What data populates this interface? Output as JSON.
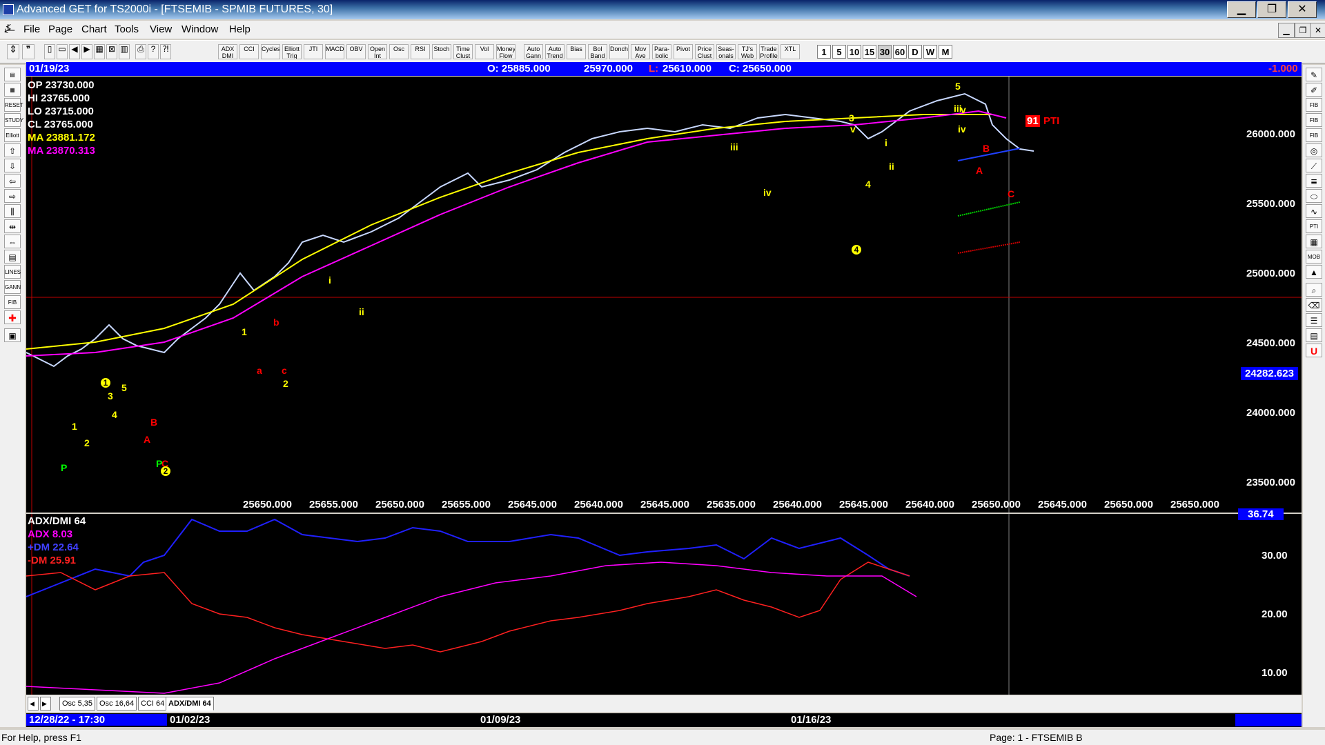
{
  "window": {
    "title": "Advanced GET for TS2000i - [FTSEMIB - SPMIB FUTURES, 30]",
    "minimize": "▁",
    "restore": "❐",
    "close": "✕"
  },
  "menu": [
    "File",
    "Page",
    "Chart",
    "Tools",
    "View",
    "Window",
    "Help"
  ],
  "toolbar": {
    "study_buttons": [
      "ADX DMI",
      "CCI",
      "Cycles",
      "Elliott Trig",
      "JTI",
      "MACD",
      "OBV",
      "Open Int",
      "Osc",
      "RSI",
      "Stoch",
      "Time Clust",
      "Vol",
      "Money Flow",
      "Auto Gann",
      "Auto Trend",
      "Bias",
      "Bol Band",
      "Donch",
      "Mov Ave",
      "Para-bolic",
      "Pivot",
      "Price Clust",
      "Seas-onals",
      "TJ's Web",
      "Trade Profile",
      "XTL"
    ],
    "intervals": [
      "1",
      "5",
      "10",
      "15",
      "30",
      "60",
      "D",
      "W",
      "M"
    ],
    "active_interval": "30"
  },
  "infobar": {
    "date": "01/19/23",
    "open": "O: 25885.000",
    "high": "25970.000",
    "low_label": "L:",
    "low": "25610.000",
    "close": "C: 25650.000",
    "change": "-1.000"
  },
  "legend": {
    "op": "OP  23730.000",
    "hi": "HI   23765.000",
    "lo": "LO  23715.000",
    "cl": "CL  23765.000",
    "ma1": "MA  23881.172",
    "ma2": "MA  23870.313"
  },
  "price_axis": [
    "26000.000",
    "25500.000",
    "25000.000",
    "24500.000",
    "24000.000",
    "23500.000"
  ],
  "crosshair_price": "24282.623",
  "bottom_values": [
    "25650.000",
    "25655.000",
    "25650.000",
    "25655.000",
    "25645.000",
    "25640.000",
    "25645.000",
    "25635.000",
    "25640.000",
    "25645.000",
    "25640.000",
    "25650.000",
    "25645.000",
    "25650.000",
    "25650.000"
  ],
  "pti_label": "PTI",
  "pti_value": "91",
  "oscillator": {
    "name": "ADX/DMI 64",
    "adx": "ADX 8.03",
    "plus_dm": "+DM 22.64",
    "minus_dm": "-DM  25.91",
    "top_value": "36.74",
    "axis": [
      "30.00",
      "20.00",
      "10.00"
    ]
  },
  "tabs": [
    "Osc 5,35",
    "Osc 16,64",
    "CCI 64",
    "ADX/DMI 64"
  ],
  "dates": [
    "12/28/22 - 17:30",
    "01/02/23",
    "01/09/23",
    "01/16/23"
  ],
  "status": {
    "help": "For Help, press F1",
    "page": "Page: 1 - FTSEMIB B"
  },
  "wave_labels": [
    {
      "t": "1",
      "c": "#ffff00"
    },
    {
      "t": "2",
      "c": "#ffff00"
    },
    {
      "t": "3",
      "c": "#ffff00"
    },
    {
      "t": "4",
      "c": "#ffff00"
    },
    {
      "t": "5",
      "c": "#ffff00"
    },
    {
      "t": "P",
      "c": "#00ff00"
    },
    {
      "t": "A",
      "c": "#ff0000"
    },
    {
      "t": "B",
      "c": "#ff0000"
    },
    {
      "t": "C",
      "c": "#ff0000"
    },
    {
      "t": "P",
      "c": "#00ff00"
    },
    {
      "t": "1",
      "c": "#ffff00"
    },
    {
      "t": "b",
      "c": "#ff0000"
    },
    {
      "t": "a",
      "c": "#ff0000"
    },
    {
      "t": "c",
      "c": "#ff0000"
    },
    {
      "t": "2",
      "c": "#ffff00"
    },
    {
      "t": "i",
      "c": "#ffff00"
    },
    {
      "t": "ii",
      "c": "#ffff00"
    },
    {
      "t": "iii",
      "c": "#ffff00"
    },
    {
      "t": "iv",
      "c": "#ffff00"
    },
    {
      "t": "3",
      "c": "#ffff00"
    },
    {
      "t": "v",
      "c": "#ffff00"
    },
    {
      "t": "4",
      "c": "#ffff00"
    },
    {
      "t": "i",
      "c": "#ffff00"
    },
    {
      "t": "ii",
      "c": "#ffff00"
    },
    {
      "t": "5",
      "c": "#ffff00"
    },
    {
      "t": "iii",
      "c": "#ffff00"
    },
    {
      "t": "v",
      "c": "#ffff00"
    },
    {
      "t": "iv",
      "c": "#ffff00"
    },
    {
      "t": "B",
      "c": "#ff0000"
    },
    {
      "t": "A",
      "c": "#ff0000"
    },
    {
      "t": "C",
      "c": "#ff0000"
    }
  ],
  "circled_labels": [
    "1",
    "2",
    "4"
  ]
}
